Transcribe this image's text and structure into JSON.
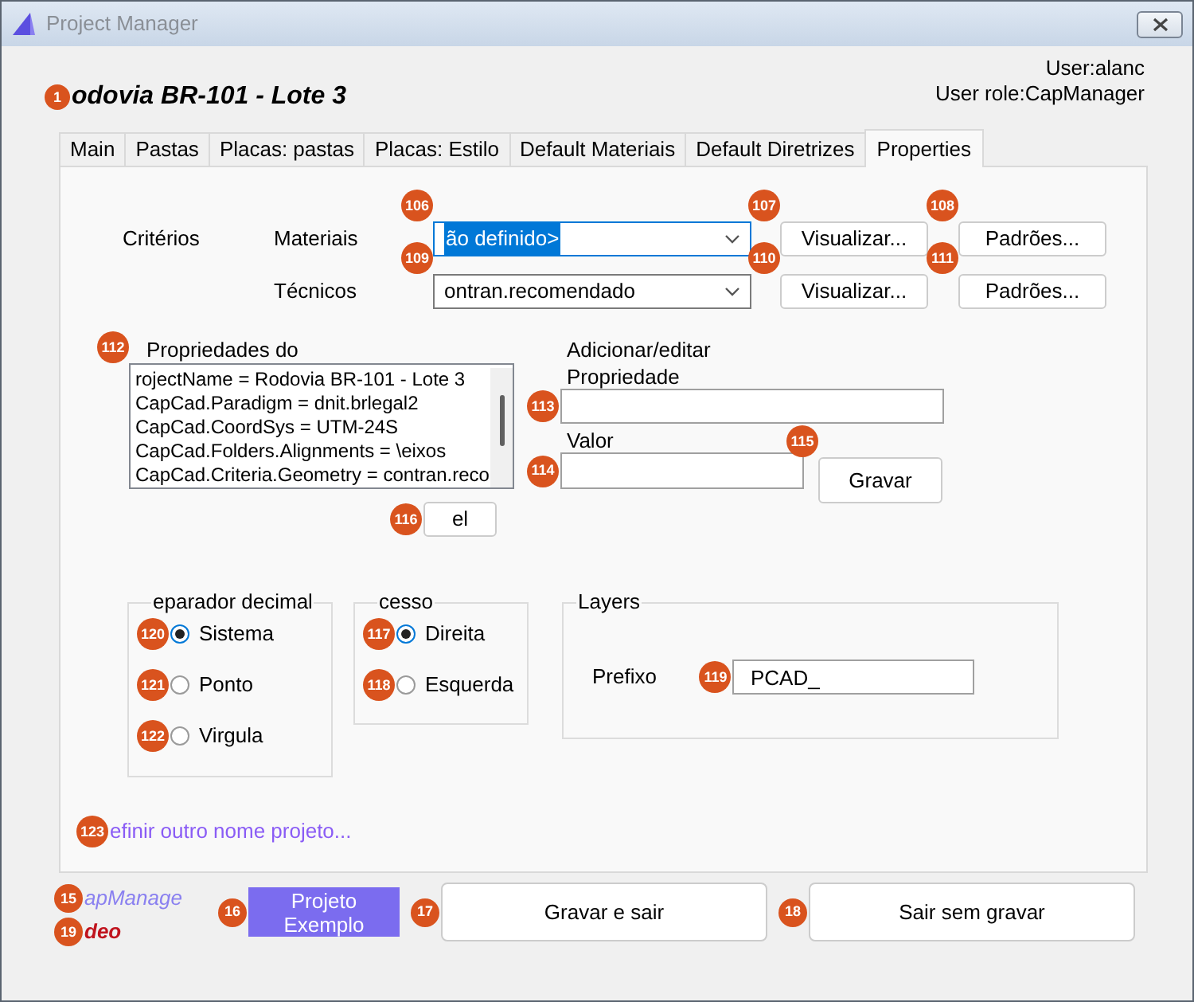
{
  "window": {
    "title": "Project Manager"
  },
  "project": {
    "title": "odovia BR-101 - Lote 3",
    "badge": "1"
  },
  "user": {
    "name": "User:alanc",
    "role": "User role:CapManager"
  },
  "tabs": [
    {
      "label": "Main",
      "selected": false
    },
    {
      "label": "Pastas",
      "selected": false
    },
    {
      "label": "Placas: pastas",
      "selected": false
    },
    {
      "label": "Placas: Estilo",
      "selected": false
    },
    {
      "label": "Default Materiais",
      "selected": false
    },
    {
      "label": "Default Diretrizes",
      "selected": false
    },
    {
      "label": "Properties",
      "selected": true
    }
  ],
  "criteria": {
    "label": "Critérios",
    "rows": [
      {
        "label": "Materiais",
        "combo": {
          "value": "ão definido>",
          "focused": true,
          "badge": "106"
        },
        "view": {
          "label": "Visualizar...",
          "badge": "107"
        },
        "defaults": {
          "label": "Padrões...",
          "badge": "108"
        }
      },
      {
        "label": "Técnicos",
        "combo": {
          "value": "ontran.recomendado",
          "focused": false,
          "badge": "109"
        },
        "view": {
          "label": "Visualizar...",
          "badge": "110"
        },
        "defaults": {
          "label": "Padrões...",
          "badge": "111"
        }
      }
    ]
  },
  "properties": {
    "label": "Propriedades do",
    "list": {
      "badge": "112",
      "items": [
        "rojectName = Rodovia BR-101 - Lote 3",
        "CapCad.Paradigm = dnit.brlegal2",
        "CapCad.CoordSys = UTM-24S",
        "CapCad.Folders.Alignments = \\eixos",
        "CapCad.Criteria.Geometry = contran.reco"
      ]
    },
    "delete": {
      "label": "el",
      "badge": "116"
    }
  },
  "editor": {
    "label": "Adicionar/editar",
    "property_label": "Propriedade",
    "property": {
      "badge": "113"
    },
    "value_label": "Valor",
    "value": {
      "badge": "114"
    },
    "save": {
      "label": "Gravar",
      "badge": "115"
    }
  },
  "decimal_separator": {
    "title": "eparador decimal",
    "options": [
      {
        "label": "Sistema",
        "selected": true,
        "badge": "120"
      },
      {
        "label": "Ponto",
        "selected": false,
        "badge": "121"
      },
      {
        "label": "Virgula",
        "selected": false,
        "badge": "122"
      }
    ]
  },
  "access": {
    "title": "cesso",
    "options": [
      {
        "label": "Direita",
        "selected": true,
        "badge": "117"
      },
      {
        "label": "Esquerda",
        "selected": false,
        "badge": "118"
      }
    ]
  },
  "layers": {
    "title": "Layers",
    "prefix_label": "Prefixo",
    "prefix": {
      "value": "PCAD_",
      "badge": "119"
    }
  },
  "rename_link": {
    "label": "efinir outro nome projeto...",
    "badge": "123"
  },
  "footer": {
    "brand": {
      "label": "apManage",
      "badge": "15"
    },
    "video": {
      "label": "deo",
      "badge": "19"
    },
    "buttons": [
      {
        "label": "Projeto Exemplo",
        "kind": "primary",
        "badge": "16"
      },
      {
        "label": "Gravar e sair",
        "kind": "default",
        "badge": "17"
      },
      {
        "label": "Sair sem gravar",
        "kind": "default",
        "badge": "18"
      }
    ]
  }
}
